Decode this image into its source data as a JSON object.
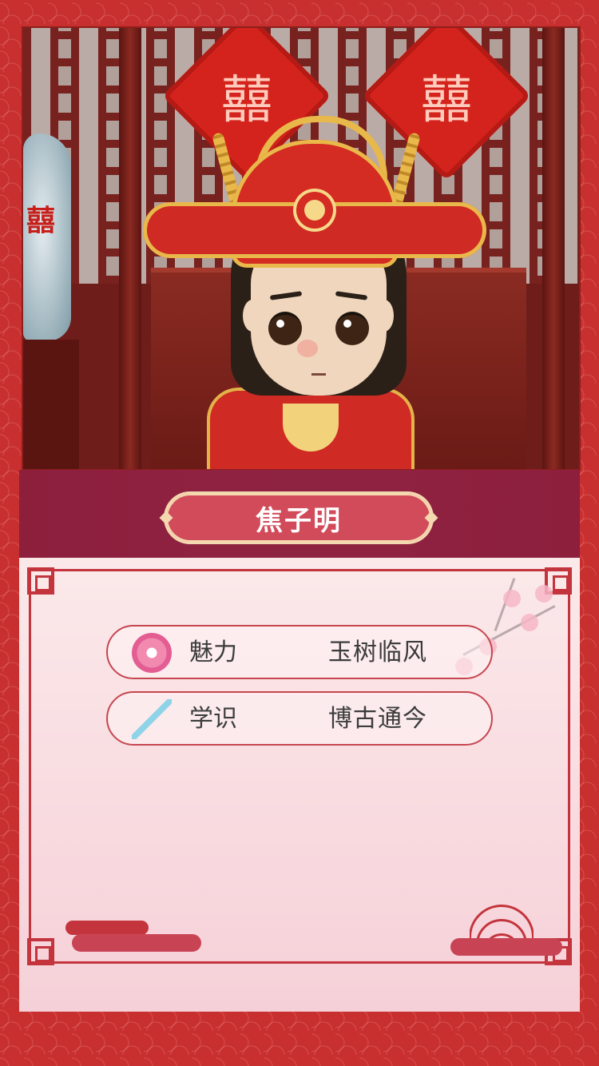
{
  "scene": {
    "wall_characters": [
      "囍",
      "囍"
    ],
    "vase_character": "囍"
  },
  "character": {
    "name": "焦子明"
  },
  "attributes": [
    {
      "icon": "plum-blossom-icon",
      "label": "魅力",
      "value": "玉树临风"
    },
    {
      "icon": "brush-icon",
      "label": "学识",
      "value": "博古通今"
    }
  ],
  "colors": {
    "frame": "#c8302f",
    "banner": "#8d1f3d",
    "name_plate": "#d14b5a",
    "panel": "#fbe9ea",
    "border": "#c4343c"
  }
}
